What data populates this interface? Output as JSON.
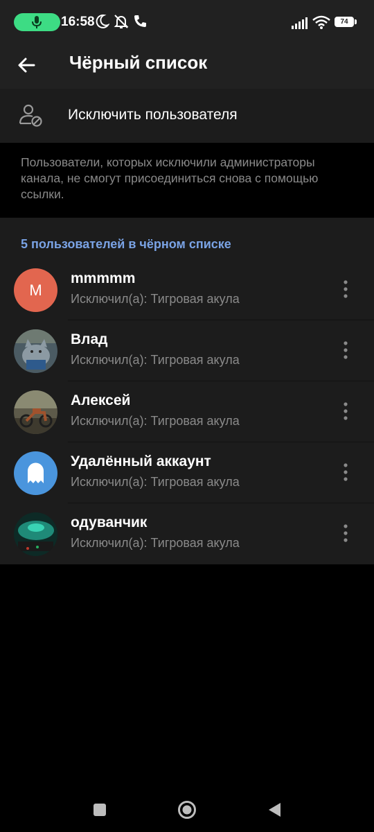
{
  "status_bar": {
    "time": "16:58",
    "battery": "74"
  },
  "header": {
    "title": "Чёрный список"
  },
  "kick_action": {
    "label": "Исключить пользователя"
  },
  "info_text": "Пользователи, которых исключили администраторы канала, не смогут присоединиться снова с помощью ссылки.",
  "section_title": "5 пользователей в чёрном списке",
  "users": [
    {
      "name": "mmmmm",
      "subtitle": "Исключил(а): Тигровая акула",
      "avatar_letter": "M",
      "avatar_color": "#e2664f"
    },
    {
      "name": "Влад",
      "subtitle": "Исключил(а): Тигровая акула"
    },
    {
      "name": "Алексей",
      "subtitle": "Исключил(а): Тигровая акула"
    },
    {
      "name": "Удалённый аккаунт",
      "subtitle": "Исключил(а): Тигровая акула",
      "avatar_color": "#4a95dd"
    },
    {
      "name": "одуванчик",
      "subtitle": "Исключил(а): Тигровая акула"
    }
  ],
  "colors": {
    "accent": "#7aa3e5",
    "mic_active": "#3ddc84",
    "surface": "#1c1c1c",
    "header": "#212121"
  }
}
